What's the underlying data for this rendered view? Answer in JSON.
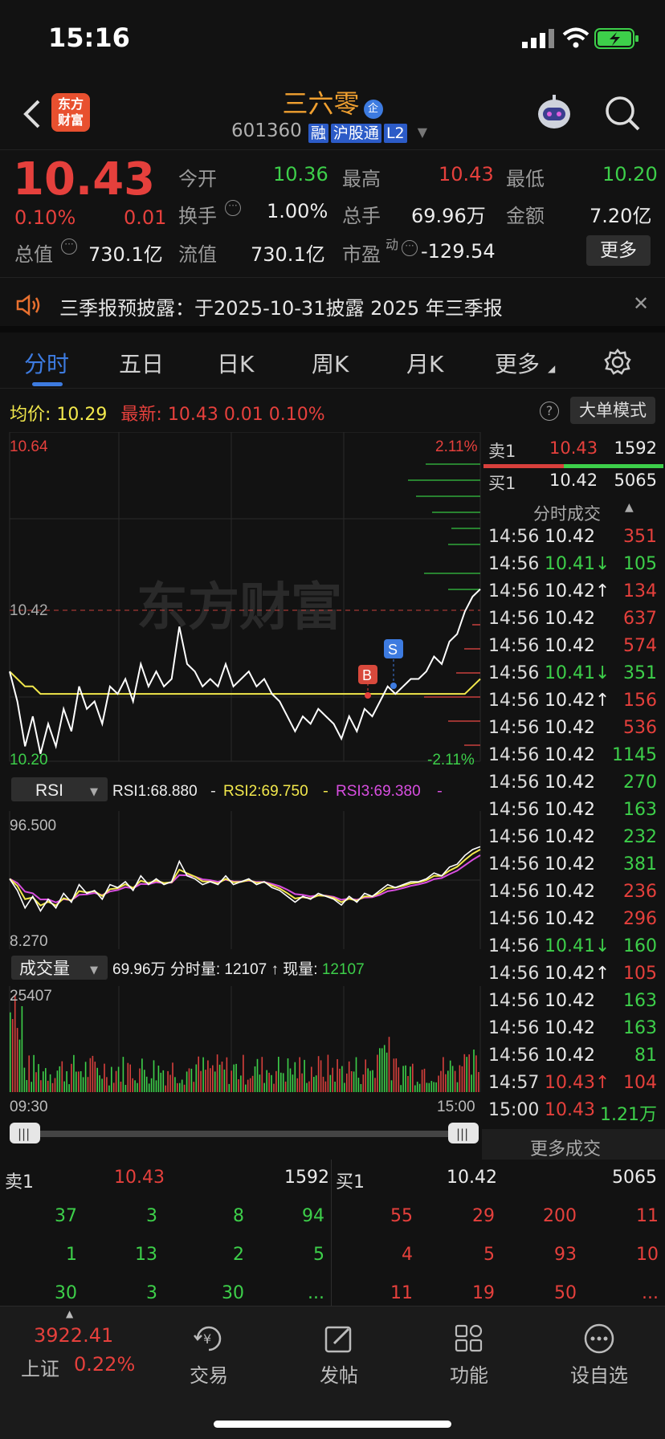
{
  "status": {
    "time": "15:16"
  },
  "header": {
    "name": "三六零",
    "badge": "企",
    "code": "601360",
    "tags": [
      "融",
      "沪股通",
      "L2"
    ],
    "logo": "东方\n财富"
  },
  "quote": {
    "price": "10.43",
    "pct": "0.10%",
    "chg": "0.01",
    "open_label": "今开",
    "open": "10.36",
    "high_label": "最高",
    "high": "10.43",
    "low_label": "最低",
    "low": "10.20",
    "turnover_label": "换手",
    "turnover": "1.00%",
    "vol_label": "总手",
    "vol": "69.96万",
    "amount_label": "金额",
    "amount": "7.20亿",
    "mcap_label": "总值",
    "mcap": "730.1亿",
    "float_label": "流值",
    "float": "730.1亿",
    "pe_label": "市盈",
    "pe_sup": "动",
    "pe": "-129.54",
    "more": "更多"
  },
  "notice": {
    "text": "三季报预披露：于2025-10-31披露 2025 年三季报"
  },
  "tabs": [
    "分时",
    "五日",
    "日K",
    "周K",
    "月K",
    "更多"
  ],
  "avgbar": {
    "avg_label": "均价:",
    "avg": "10.29",
    "last_label": "最新:",
    "last": "10.43",
    "chg": "0.01",
    "pct": "0.10%",
    "mode": "大单模式",
    "help": "?"
  },
  "chart": {
    "top_price": "10.64",
    "top_pct": "2.11%",
    "mid_price": "10.42",
    "bot_price": "10.20",
    "bot_pct": "-2.11%",
    "watermark": "东方财富",
    "b_label": "B",
    "s_label": "S"
  },
  "chart_data": {
    "type": "line",
    "ylim": [
      10.2,
      10.64
    ],
    "x_start": "09:30",
    "x_end": "15:00",
    "price": [
      10.32,
      10.28,
      10.22,
      10.26,
      10.21,
      10.25,
      10.22,
      10.27,
      10.24,
      10.3,
      10.27,
      10.28,
      10.25,
      10.3,
      10.29,
      10.31,
      10.28,
      10.33,
      10.3,
      10.32,
      10.3,
      10.31,
      10.38,
      10.33,
      10.32,
      10.3,
      10.31,
      10.3,
      10.33,
      10.3,
      10.31,
      10.32,
      10.3,
      10.31,
      10.29,
      10.28,
      10.26,
      10.24,
      10.26,
      10.25,
      10.27,
      10.26,
      10.25,
      10.23,
      10.26,
      10.24,
      10.27,
      10.26,
      10.28,
      10.3,
      10.29,
      10.3,
      10.31,
      10.31,
      10.32,
      10.34,
      10.33,
      10.36,
      10.37,
      10.4,
      10.42,
      10.43
    ],
    "avg": [
      10.32,
      10.31,
      10.3,
      10.3,
      10.29,
      10.29,
      10.29,
      10.29,
      10.29,
      10.29,
      10.29,
      10.29,
      10.29,
      10.29,
      10.29,
      10.29,
      10.29,
      10.29,
      10.29,
      10.29,
      10.29,
      10.29,
      10.29,
      10.29,
      10.29,
      10.29,
      10.29,
      10.29,
      10.29,
      10.29,
      10.29,
      10.29,
      10.29,
      10.29,
      10.29,
      10.29,
      10.29,
      10.29,
      10.29,
      10.29,
      10.29,
      10.29,
      10.29,
      10.29,
      10.29,
      10.29,
      10.29,
      10.29,
      10.29,
      10.29,
      10.29,
      10.29,
      10.29,
      10.29,
      10.29,
      10.29,
      10.29,
      10.29,
      10.29,
      10.29,
      10.3,
      10.31
    ]
  },
  "rsi": {
    "selector": "RSI",
    "rsi1": "RSI1:68.880",
    "rsi2": "RSI2:69.750",
    "rsi3": "RSI3:69.380",
    "dash": "-",
    "top": "96.500",
    "bottom": "8.270"
  },
  "volume": {
    "selector": "成交量",
    "total": "69.96万",
    "period_label": "分时量:",
    "period": "12107",
    "arrow": "↑",
    "now_label": "现量:",
    "now": "12107",
    "max": "25407",
    "start": "09:30",
    "end": "15:00"
  },
  "side": {
    "sell1_label": "卖1",
    "sell1_price": "10.43",
    "sell1_vol": "1592",
    "buy1_label": "买1",
    "buy1_price": "10.42",
    "buy1_vol": "5065",
    "ticks_title": "分时成交",
    "more": "更多成交"
  },
  "ticks": [
    [
      "14:56",
      "10.42",
      "351",
      "w",
      "r"
    ],
    [
      "14:56",
      "10.41↓",
      "105",
      "g",
      "g"
    ],
    [
      "14:56",
      "10.42↑",
      "134",
      "w",
      "r"
    ],
    [
      "14:56",
      "10.42",
      "637",
      "w",
      "r"
    ],
    [
      "14:56",
      "10.42",
      "574",
      "w",
      "r"
    ],
    [
      "14:56",
      "10.41↓",
      "351",
      "g",
      "g"
    ],
    [
      "14:56",
      "10.42↑",
      "156",
      "w",
      "r"
    ],
    [
      "14:56",
      "10.42",
      "536",
      "w",
      "r"
    ],
    [
      "14:56",
      "10.42",
      "1145",
      "w",
      "g"
    ],
    [
      "14:56",
      "10.42",
      "270",
      "w",
      "g"
    ],
    [
      "14:56",
      "10.42",
      "163",
      "w",
      "g"
    ],
    [
      "14:56",
      "10.42",
      "232",
      "w",
      "g"
    ],
    [
      "14:56",
      "10.42",
      "381",
      "w",
      "g"
    ],
    [
      "14:56",
      "10.42",
      "236",
      "w",
      "r"
    ],
    [
      "14:56",
      "10.42",
      "296",
      "w",
      "r"
    ],
    [
      "14:56",
      "10.41↓",
      "160",
      "g",
      "g"
    ],
    [
      "14:56",
      "10.42↑",
      "105",
      "w",
      "r"
    ],
    [
      "14:56",
      "10.42",
      "163",
      "w",
      "g"
    ],
    [
      "14:56",
      "10.42",
      "163",
      "w",
      "g"
    ],
    [
      "14:56",
      "10.42",
      "81",
      "w",
      "g"
    ],
    [
      "14:57",
      "10.43↑",
      "104",
      "r",
      "r"
    ],
    [
      "15:00",
      "10.43",
      "1.21万",
      "r",
      "g"
    ]
  ],
  "depth": {
    "sell_label": "卖1",
    "sell_price": "10.43",
    "sell_vol": "1592",
    "buy_label": "买1",
    "buy_price": "10.42",
    "buy_vol": "5065",
    "sell_rows": [
      [
        "37",
        "3",
        "8",
        "94"
      ],
      [
        "1",
        "13",
        "2",
        "5"
      ],
      [
        "30",
        "3",
        "30",
        "..."
      ]
    ],
    "buy_rows": [
      [
        "55",
        "29",
        "200",
        "11"
      ],
      [
        "4",
        "5",
        "93",
        "10"
      ],
      [
        "11",
        "19",
        "50",
        "..."
      ]
    ]
  },
  "nav": {
    "index_value": "3922.41",
    "index_name": "上证",
    "index_pct": "0.22%",
    "items": [
      "交易",
      "发帖",
      "功能",
      "设自选"
    ]
  }
}
